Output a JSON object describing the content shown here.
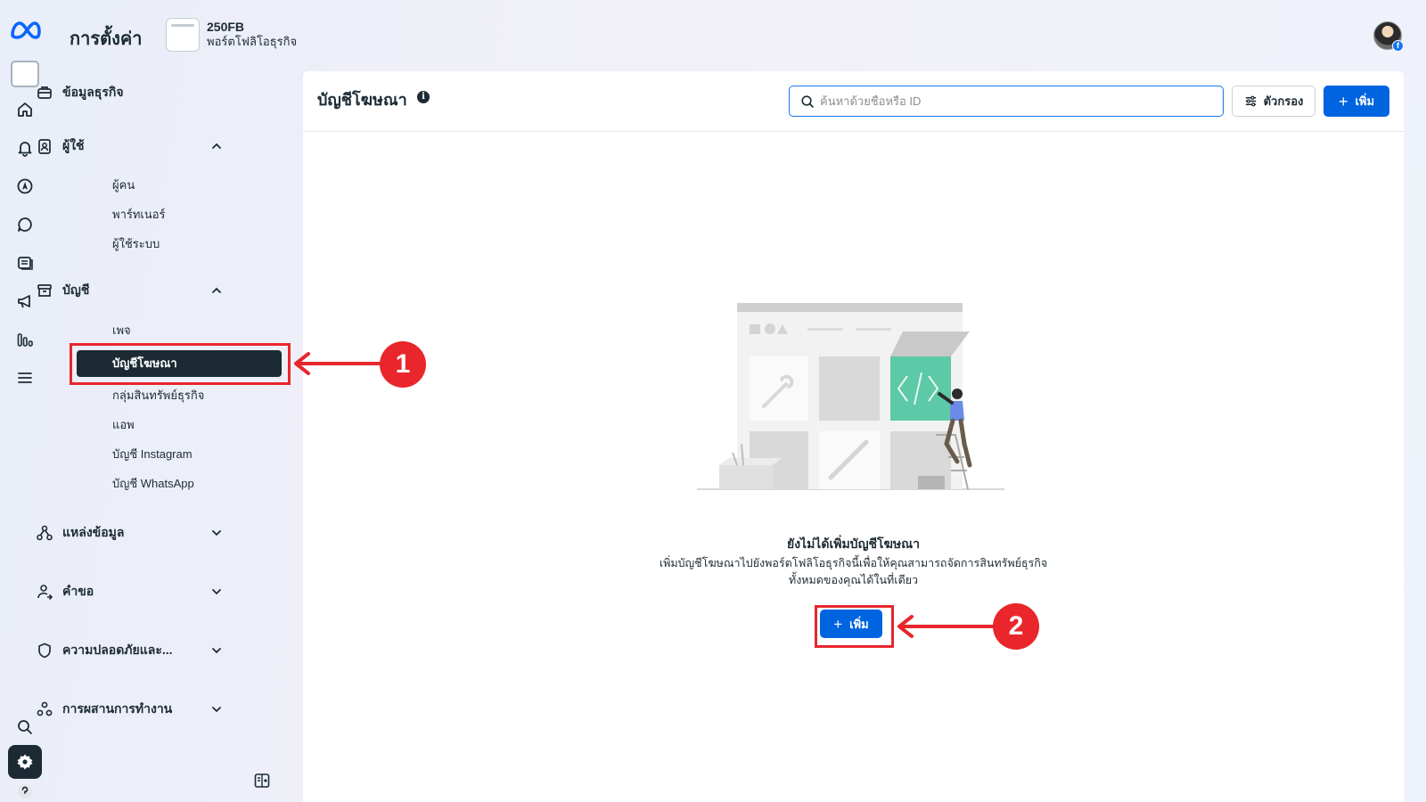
{
  "header": {
    "title": "การตั้งค่า",
    "business_name": "250FB",
    "business_subtitle": "พอร์ตโฟลิโอธุรกิจ"
  },
  "rail": {
    "items": [
      "meta-logo",
      "business-thumbnail",
      "home-icon",
      "bell-icon",
      "compass-icon",
      "chat-icon",
      "inbox-icon",
      "megaphone-icon",
      "insights-icon",
      "menu-icon"
    ],
    "bottom_items": [
      "search-icon",
      "gear-icon",
      "help-icon"
    ]
  },
  "sidebar": {
    "business_info": "ข้อมูลธุรกิจ",
    "users": {
      "label": "ผู้ใช้",
      "items": [
        "ผู้คน",
        "พาร์ทเนอร์",
        "ผู้ใช้ระบบ"
      ]
    },
    "accounts": {
      "label": "บัญชี",
      "items": [
        "เพจ",
        "บัญชีโฆษณา",
        "กลุ่มสินทรัพย์ธุรกิจ",
        "แอพ",
        "บัญชี Instagram",
        "บัญชี WhatsApp"
      ],
      "active_index": 1
    },
    "data_sources": "แหล่งข้อมูล",
    "requests": "คำขอ",
    "security": "ความปลอดภัยและ...",
    "integrations": "การผสานการทำงาน"
  },
  "main": {
    "page_title": "บัญชีโฆษณา",
    "search_placeholder": "ค้นหาด้วยชื่อหรือ ID",
    "filter_label": "ตัวกรอง",
    "add_label": "เพิ่ม",
    "empty_state": {
      "title": "ยังไม่ได้เพิ่มบัญชีโฆษณา",
      "desc_line1": "เพิ่มบัญชีโฆษณาไปยังพอร์ตโฟลิโอธุรกิจนี้เพื่อให้คุณสามารถจัดการสินทรัพย์ธุรกิจ",
      "desc_line2": "ทั้งหมดของคุณได้ในที่เดียว",
      "add_label": "เพิ่ม"
    }
  },
  "annotations": {
    "step1": "1",
    "step2": "2"
  },
  "colors": {
    "primary": "#0064e0",
    "active_nav": "#1c2b33",
    "annotation": "#e8262c",
    "illustration_green": "#5cc9a7",
    "illustration_blue": "#6a8ce8"
  }
}
